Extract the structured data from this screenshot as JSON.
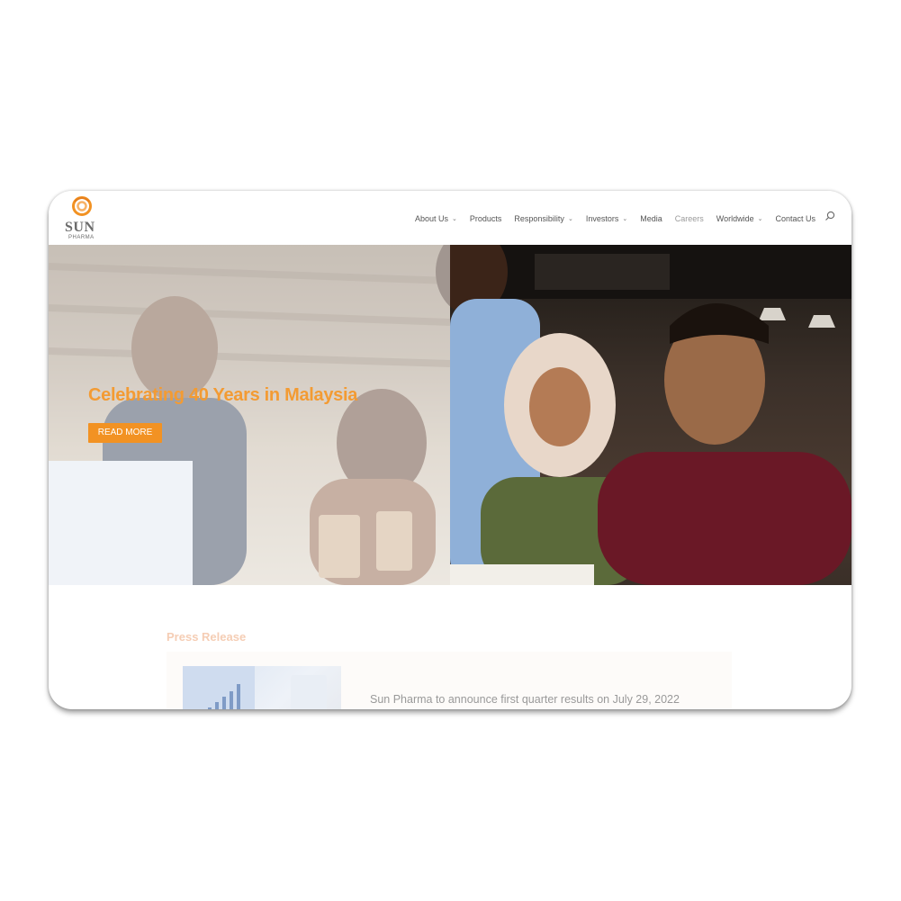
{
  "brand": {
    "name": "SUN",
    "sub": "PHARMA",
    "accent_color": "#f29223",
    "logo_icon": "sun-swirl-logo-icon"
  },
  "nav": {
    "items": [
      {
        "label": "About Us",
        "dropdown": true
      },
      {
        "label": "Products",
        "dropdown": false
      },
      {
        "label": "Responsibility",
        "dropdown": true
      },
      {
        "label": "Investors",
        "dropdown": true
      },
      {
        "label": "Media",
        "dropdown": false
      },
      {
        "label": "Careers",
        "dropdown": false
      },
      {
        "label": "Worldwide",
        "dropdown": true
      },
      {
        "label": "Contact Us",
        "dropdown": false
      }
    ],
    "chevron": "⌄",
    "search_icon": "search-icon"
  },
  "hero": {
    "title": "Celebrating 40 Years in Malaysia",
    "button_label": "READ MORE",
    "title_color": "#f39b33"
  },
  "press": {
    "section_title": "Press Release",
    "headline": "Sun Pharma to announce first quarter results on July 29, 2022"
  }
}
